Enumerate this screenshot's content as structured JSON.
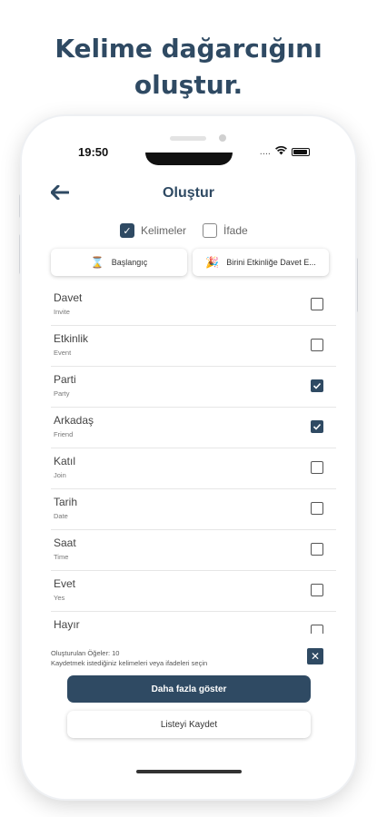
{
  "headline": {
    "line1": "Kelime dağarcığını",
    "line2": "oluştur."
  },
  "status": {
    "time": "19:50",
    "signal": "...."
  },
  "header": {
    "title": "Oluştur"
  },
  "filters": [
    {
      "label": "Kelimeler",
      "checked": true
    },
    {
      "label": "İfade",
      "checked": false
    }
  ],
  "chips": [
    {
      "icon": "⌛",
      "label": "Başlangıç"
    },
    {
      "icon": "🎉",
      "label": "Birini Etkinliğe Davet E..."
    }
  ],
  "words": [
    {
      "word": "Davet",
      "translation": "Invite",
      "checked": false
    },
    {
      "word": "Etkinlik",
      "translation": "Event",
      "checked": false
    },
    {
      "word": "Parti",
      "translation": "Party",
      "checked": true
    },
    {
      "word": "Arkadaş",
      "translation": "Friend",
      "checked": true
    },
    {
      "word": "Katıl",
      "translation": "Join",
      "checked": false
    },
    {
      "word": "Tarih",
      "translation": "Date",
      "checked": false
    },
    {
      "word": "Saat",
      "translation": "Time",
      "checked": false
    },
    {
      "word": "Evet",
      "translation": "Yes",
      "checked": false
    },
    {
      "word": "Hayır",
      "translation": "",
      "checked": false
    }
  ],
  "footer": {
    "count_text": "Oluşturulan Öğeler: 10",
    "hint_text": "Kaydetmek istediğiniz kelimeleri veya ifadeleri seçin"
  },
  "buttons": {
    "show_more": "Daha fazla göster",
    "save_list": "Listeyi Kaydet"
  },
  "colors": {
    "accent": "#2f4a63",
    "background": "#ffffff"
  }
}
